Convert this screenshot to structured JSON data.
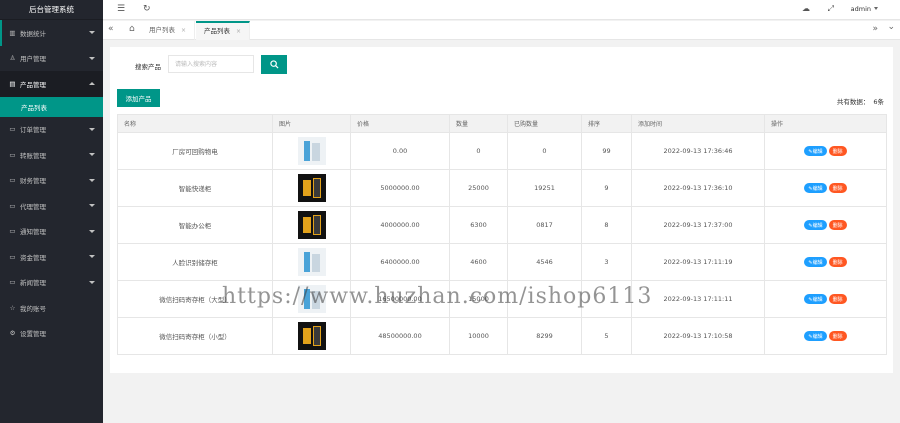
{
  "sidebar": {
    "brand": "后台管理系统",
    "items": [
      {
        "icon": "chart-icon",
        "glyph": "▥",
        "label": "数据统计",
        "open": false
      },
      {
        "icon": "user-icon",
        "glyph": "♙",
        "label": "用户管理",
        "open": false
      },
      {
        "icon": "product-icon",
        "glyph": "▤",
        "label": "产品管理",
        "open": true,
        "children": [
          {
            "label": "产品列表"
          }
        ]
      },
      {
        "icon": "order-icon",
        "glyph": "▭",
        "label": "订单管理",
        "open": false
      },
      {
        "icon": "transfer-icon",
        "glyph": "▭",
        "label": "转账管理",
        "open": false
      },
      {
        "icon": "finance-icon",
        "glyph": "▭",
        "label": "财务管理",
        "open": false
      },
      {
        "icon": "agent-icon",
        "glyph": "▭",
        "label": "代理管理",
        "open": false
      },
      {
        "icon": "notice-icon",
        "glyph": "▭",
        "label": "通知管理",
        "open": false
      },
      {
        "icon": "fund-icon",
        "glyph": "▭",
        "label": "资金管理",
        "open": false
      },
      {
        "icon": "news-icon",
        "glyph": "▭",
        "label": "新闻管理",
        "open": false
      },
      {
        "icon": "account-icon",
        "glyph": "☆",
        "label": "我的账号",
        "open": false
      },
      {
        "icon": "settings-icon",
        "glyph": "⚙",
        "label": "设置管理",
        "open": false
      }
    ]
  },
  "topbar": {
    "menu_glyph": "☰",
    "refresh_glyph": "↻",
    "theme_glyph": "☁",
    "fullscreen_glyph": "⤢",
    "user": "admin"
  },
  "tabs": {
    "prev_glyph": "«",
    "home_glyph": "⌂",
    "items": [
      {
        "label": "用户列表",
        "close": "×",
        "active": false
      },
      {
        "label": "产品列表",
        "close": "×",
        "active": true
      }
    ],
    "next_glyph": "»",
    "more_glyph": "⌄"
  },
  "search": {
    "label": "搜索产品",
    "placeholder": "请输入搜索内容",
    "button_glyph": "🔍"
  },
  "toolbar": {
    "add_label": "添加产品",
    "total_label": "共有数据：",
    "total_value": "6条"
  },
  "table": {
    "headers": [
      "名称",
      "图片",
      "价格",
      "数量",
      "已购数量",
      "排序",
      "添加时间",
      "操作"
    ],
    "rows": [
      {
        "name": "厂房可回购物电",
        "thumb": "light",
        "price": "0.00",
        "qty": "0",
        "bought": "0",
        "sort": "99",
        "time": "2022-09-13 17:36:46"
      },
      {
        "name": "智能快递柜",
        "thumb": "dark",
        "price": "5000000.00",
        "qty": "25000",
        "bought": "19251",
        "sort": "9",
        "time": "2022-09-13 17:36:10"
      },
      {
        "name": "智能办公柜",
        "thumb": "dark",
        "price": "4000000.00",
        "qty": "6300",
        "bought": "0817",
        "sort": "8",
        "time": "2022-09-13 17:37:00"
      },
      {
        "name": "人脸识别储存柜",
        "thumb": "light",
        "price": "6400000.00",
        "qty": "4600",
        "bought": "4546",
        "sort": "3",
        "time": "2022-09-13 17:11:19"
      },
      {
        "name": "微信扫码寄存柜（大型）",
        "thumb": "light",
        "price": "16500000.00",
        "qty": "15000",
        "bought": "",
        "sort": "",
        "time": "2022-09-13 17:11:11"
      },
      {
        "name": "微信扫码寄存柜（小型）",
        "thumb": "dark",
        "price": "48500000.00",
        "qty": "10000",
        "bought": "8299",
        "sort": "5",
        "time": "2022-09-13 17:10:58"
      }
    ],
    "edit_label": "✎编辑",
    "delete_label": "删除"
  },
  "watermark": "https://www.huzhan.com/ishop6113",
  "colors": {
    "accent": "#009688",
    "sidebar_bg": "#23262e",
    "edit": "#1e9fff",
    "delete": "#ff5722"
  }
}
